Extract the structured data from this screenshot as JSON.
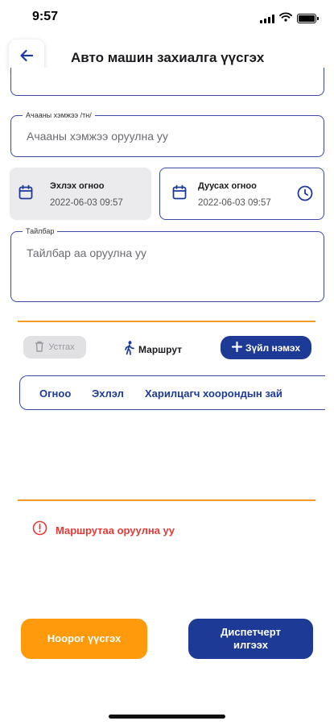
{
  "status_bar": {
    "time": "9:57",
    "icons": [
      "signal-icon",
      "wifi-icon",
      "battery-icon"
    ]
  },
  "header": {
    "back_icon": "arrow-left-icon",
    "title": "Авто машин захиалга үүсгэх"
  },
  "form": {
    "load_size": {
      "label": "Ачааны хэмжээ /тн/",
      "value": "",
      "placeholder": "Ачааны хэмжээ оруулна уу"
    },
    "start_date": {
      "title": "Эхлэх огноо",
      "value": "2022-06-03 09:57",
      "icon": "calendar-icon"
    },
    "end_date": {
      "title": "Дуусах огноо",
      "value": "2022-06-03 09:57",
      "icon": "calendar-icon",
      "trailing_icon": "clock-icon"
    },
    "description": {
      "label": "Тайлбар",
      "value": "",
      "placeholder": "Тайлбар аа оруулна уу"
    }
  },
  "route_section": {
    "clear_label": "Устгах",
    "route_label": "Маршрут",
    "add_label": "Зүйл нэмэх",
    "columns": [
      "Огноо",
      "Эхлэл",
      "Харилцагч хоорондын зай"
    ],
    "error": "Маршрутаа оруулна уу"
  },
  "actions": {
    "draft_label": "Ноорог үүсгэх",
    "send_label": "Диспетчерт илгээх"
  },
  "colors": {
    "primary": "#1d3a97",
    "accent": "#ff9a0d",
    "divider": "#f39a24",
    "error": "#e53935",
    "field_border": "#3b4aa8",
    "date_card_bg": "#ebebee"
  }
}
